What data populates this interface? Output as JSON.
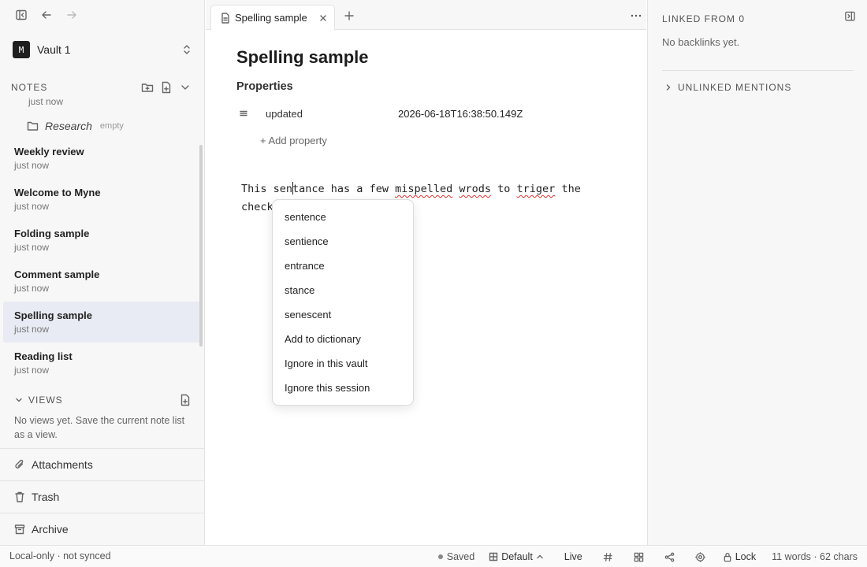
{
  "sidebar": {
    "vault_badge": "M",
    "vault_name": "Vault 1",
    "notes_label": "NOTES",
    "cutoff_subtitle": "just now",
    "folder": {
      "name": "Research",
      "state": "empty"
    },
    "notes": [
      {
        "title": "Weekly review",
        "subtitle": "just now",
        "selected": false
      },
      {
        "title": "Welcome to Myne",
        "subtitle": "just now",
        "selected": false
      },
      {
        "title": "Folding sample",
        "subtitle": "just now",
        "selected": false
      },
      {
        "title": "Comment sample",
        "subtitle": "just now",
        "selected": false
      },
      {
        "title": "Spelling sample",
        "subtitle": "just now",
        "selected": true
      },
      {
        "title": "Reading list",
        "subtitle": "just now",
        "selected": false
      }
    ],
    "views_label": "VIEWS",
    "views_empty": "No views yet. Save the current note list as a view.",
    "bottom_nav": [
      {
        "label": "Attachments",
        "icon": "paperclip-icon"
      },
      {
        "label": "Trash",
        "icon": "trash-icon"
      },
      {
        "label": "Archive",
        "icon": "archive-icon"
      }
    ]
  },
  "tabs": [
    {
      "label": "Spelling sample",
      "icon": "document-icon"
    }
  ],
  "editor": {
    "title": "Spelling sample",
    "properties_label": "Properties",
    "property": {
      "key": "updated",
      "value": "2026-06-18T16:38:50.149Z"
    },
    "add_property": "+ Add property",
    "text": {
      "p1": "This sen",
      "p2": "tance has a few ",
      "w1": "mispelled",
      "p3": " ",
      "w2": "wrods",
      "p4": " to ",
      "w3": "triger",
      "p5": " the",
      "line2": "check"
    }
  },
  "context_menu": {
    "items": [
      "sentence",
      "sentience",
      "entrance",
      "stance",
      "senescent",
      "Add to dictionary",
      "Ignore in this vault",
      "Ignore this session"
    ]
  },
  "right_panel": {
    "linked_from": "LINKED FROM 0",
    "no_backlinks": "No backlinks yet.",
    "unlinked_mentions": "UNLINKED MENTIONS"
  },
  "status_bar": {
    "sync": "Local-only · not synced",
    "saved": "Saved",
    "layout": "Default",
    "mode": "Live",
    "lock": "Lock",
    "counts": "11 words · 62 chars"
  }
}
